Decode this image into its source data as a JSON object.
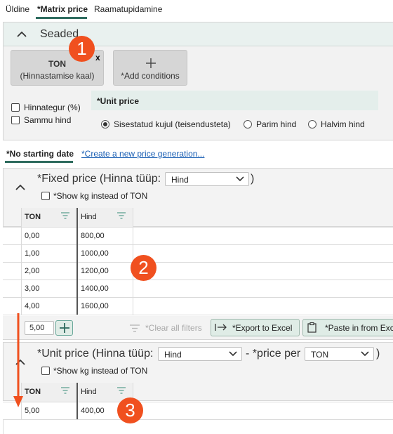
{
  "tabs": [
    {
      "label": "Üldine"
    },
    {
      "label": "*Matrix price"
    },
    {
      "label": "Raamatupidamine"
    }
  ],
  "settings": {
    "title": "Seaded",
    "chip": {
      "line1": "TON",
      "line2": "(Hinnastamise kaal)",
      "close": "x"
    },
    "add_conditions": "*Add conditions",
    "checkboxes": [
      {
        "label": "Hinnategur (%)"
      },
      {
        "label": "Sammu hind"
      }
    ],
    "unit_price_label": "*Unit price",
    "radios": [
      {
        "label": "Sisestatud kujul (teisendusteta)",
        "selected": true
      },
      {
        "label": "Parim hind",
        "selected": false
      },
      {
        "label": "Halvim hind",
        "selected": false
      }
    ]
  },
  "subtabs": [
    {
      "label": "*No starting date"
    },
    {
      "label": "*Create a new price generation..."
    }
  ],
  "fixed": {
    "title_prefix": "*Fixed price (Hinna tüüp:",
    "title_suffix": ")",
    "select_value": "Hind",
    "show_kg": "*Show kg instead of TON",
    "col1": "TON",
    "col2": "Hind",
    "rows": [
      {
        "ton": "0,00",
        "hind": "800,00"
      },
      {
        "ton": "1,00",
        "hind": "1000,00"
      },
      {
        "ton": "2,00",
        "hind": "1200,00"
      },
      {
        "ton": "3,00",
        "hind": "1400,00"
      },
      {
        "ton": "4,00",
        "hind": "1600,00"
      }
    ],
    "step_value": "5,00",
    "clear_filters": "*Clear all filters",
    "export": "*Export to Excel",
    "paste": "*Paste in from Exc"
  },
  "unit": {
    "title_prefix": "*Unit price (Hinna tüüp:",
    "select_value": "Hind",
    "mid_text": "- *price per",
    "select2_value": "TON",
    "title_suffix": ")",
    "show_kg": "*Show kg instead of TON",
    "col1": "TON",
    "col2": "Hind",
    "rows": [
      {
        "ton": "5,00",
        "hind": "400,00"
      }
    ]
  },
  "annotations": [
    "1",
    "2",
    "3"
  ],
  "colors": {
    "accent": "#2e6b5e",
    "badge": "#f0501f",
    "link": "#1a5fb4"
  }
}
